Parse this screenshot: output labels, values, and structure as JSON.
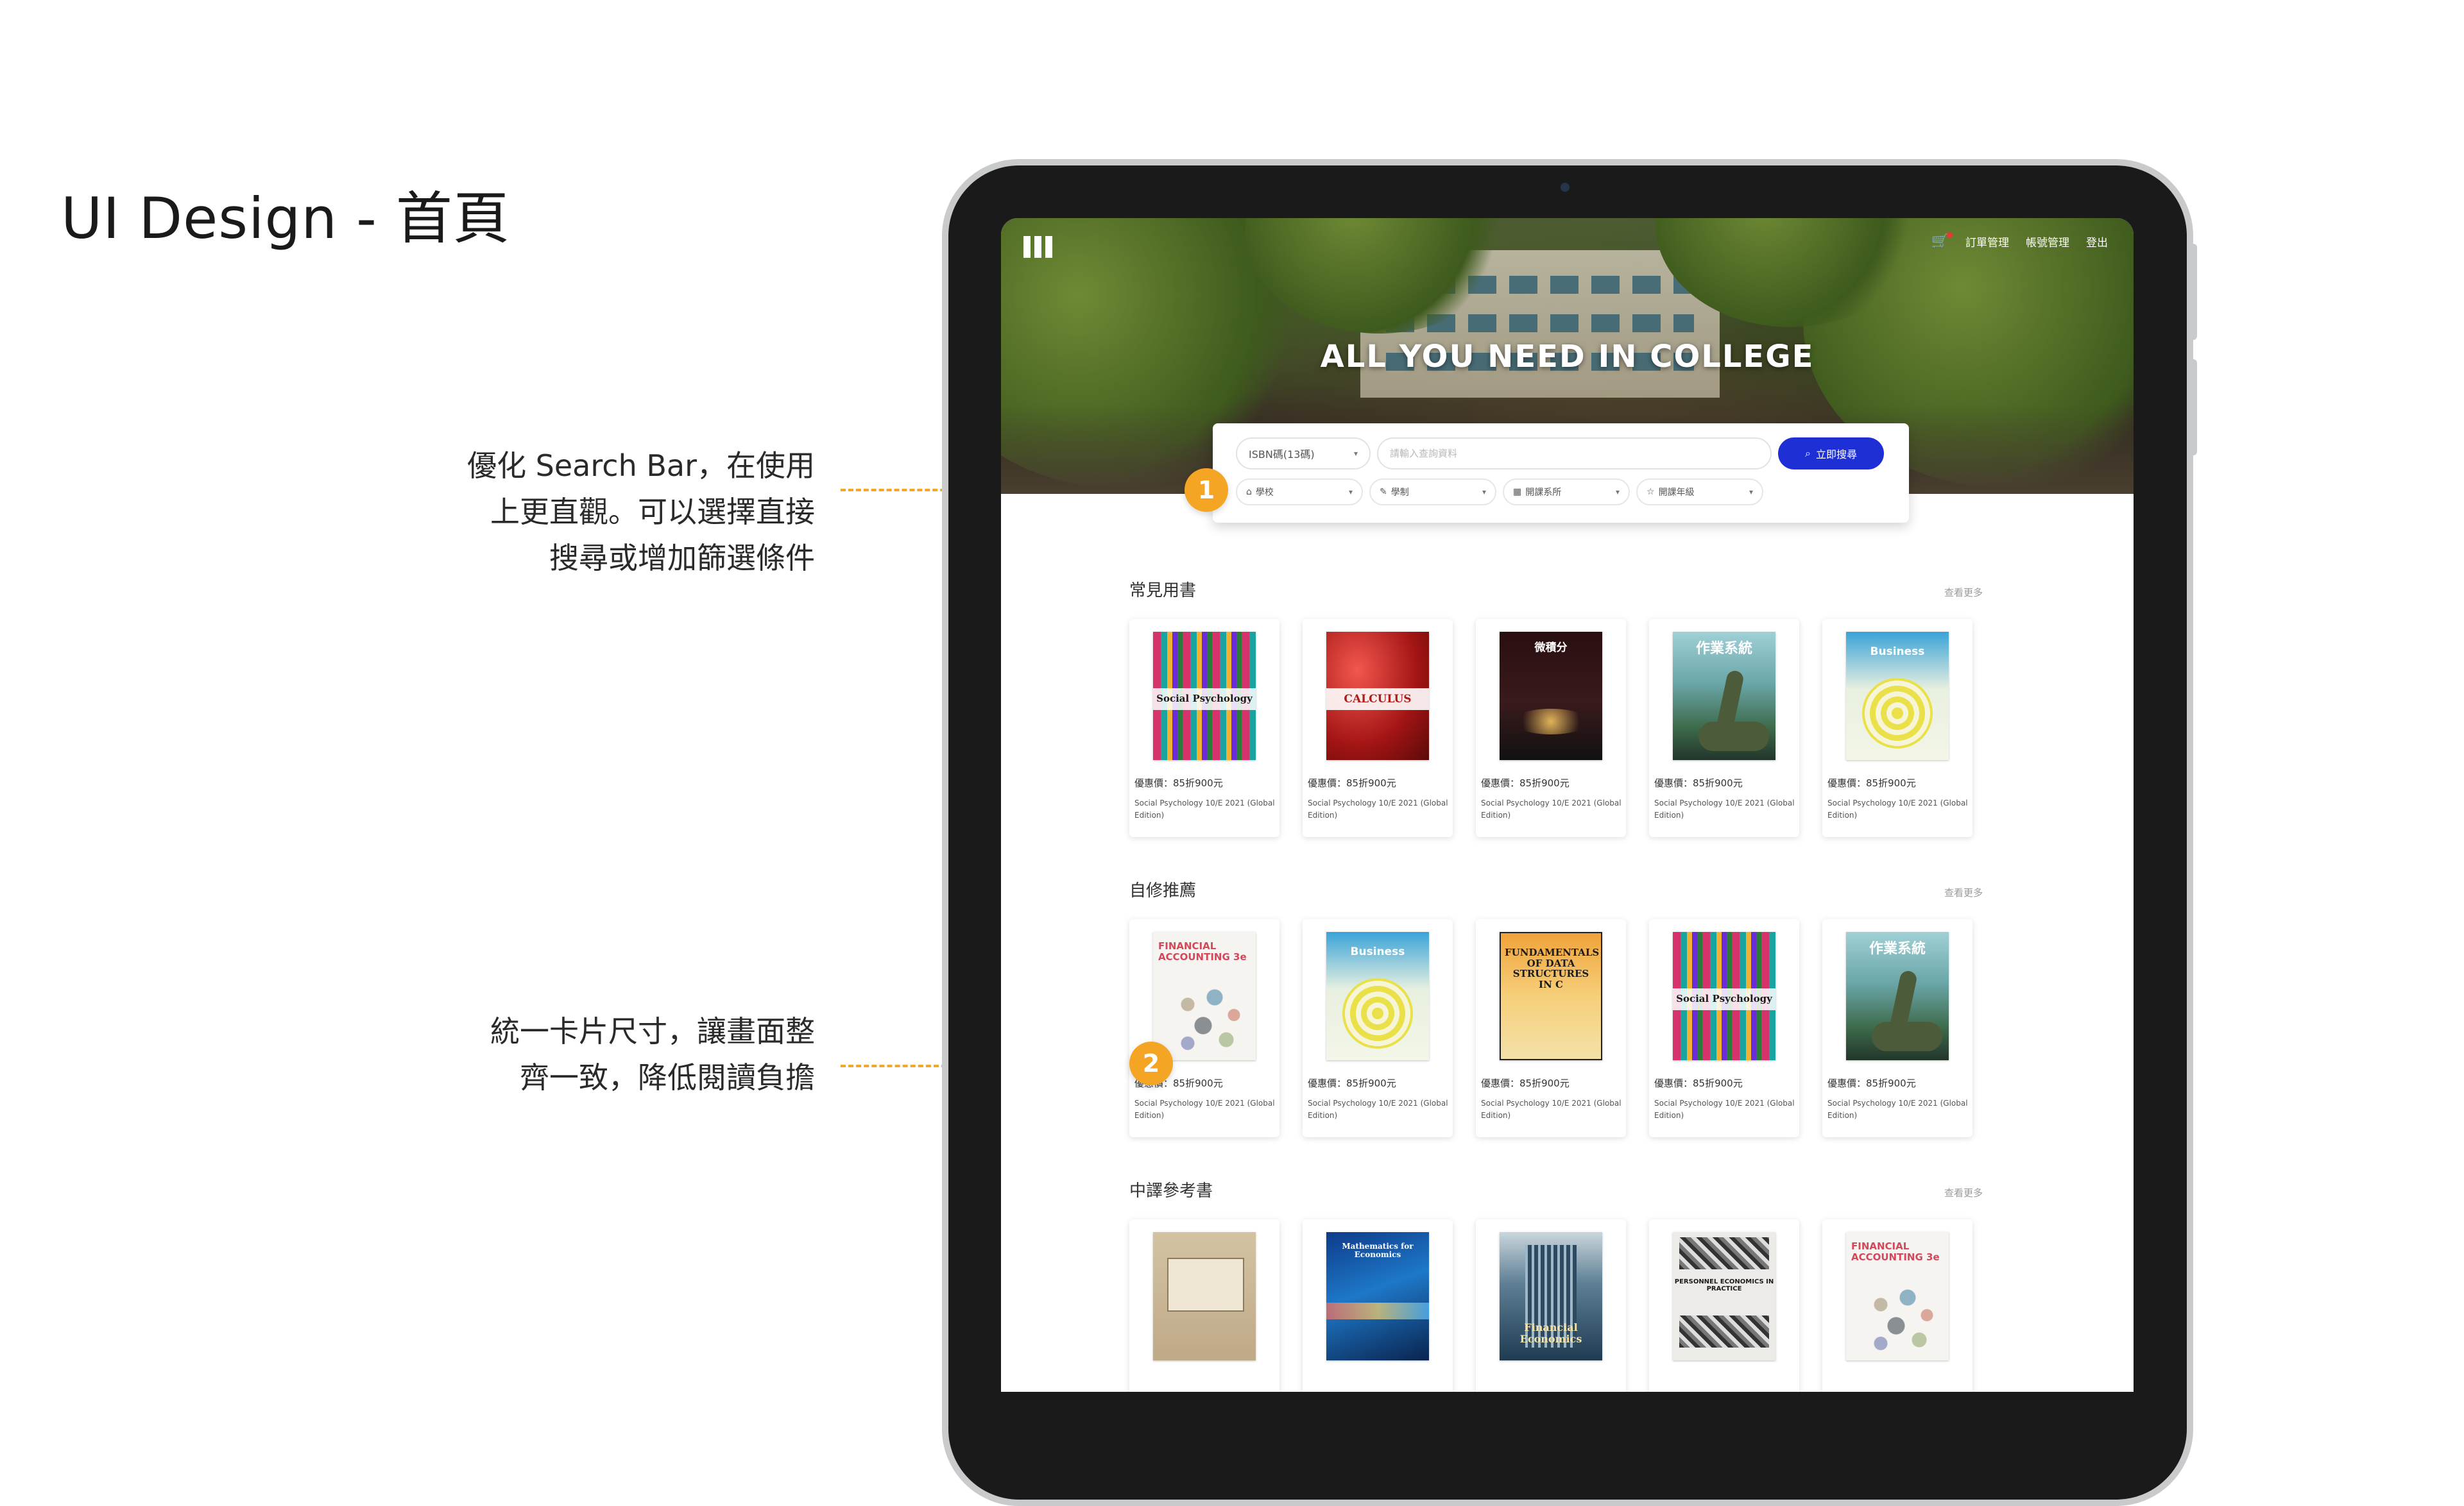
{
  "slide": {
    "title": "UI Design - 首頁",
    "annotation_1": [
      "優化 Search Bar，在使用",
      "上更直觀。可以選擇直接",
      "搜尋或增加篩選條件"
    ],
    "annotation_2": [
      "統一卡片尺寸，讓畫面整",
      "齊一致，降低閱讀負擔"
    ],
    "badge_1": "1",
    "badge_2": "2",
    "accent_color": "#f5a524"
  },
  "nav": {
    "logo_icon": "bars-logo-icon",
    "cart_icon": "cart-icon",
    "items": [
      "訂單管理",
      "帳號管理",
      "登出"
    ]
  },
  "hero": {
    "title": "ALL YOU NEED IN COLLEGE"
  },
  "search": {
    "type_select": "ISBN碼(13碼)",
    "input_placeholder": "請輸入查詢資料",
    "button_label": "立即搜尋",
    "button_color": "#1e2fd6",
    "filters": [
      {
        "icon": "school-icon",
        "label": "學校"
      },
      {
        "icon": "graduation-cap-icon",
        "label": "學制"
      },
      {
        "icon": "building-icon",
        "label": "開課系所"
      },
      {
        "icon": "star-icon",
        "label": "開課年級"
      }
    ]
  },
  "sections": [
    {
      "title": "常見用書",
      "more": "查看更多",
      "books": [
        {
          "cover": "social-psychology",
          "cover_text": "Social Psychology",
          "price": "優惠價：85折900元",
          "name": "Social Psychology 10/E 2021 (Global Edition)"
        },
        {
          "cover": "calculus",
          "cover_text": "CALCULUS",
          "price": "優惠價：85折900元",
          "name": "Social Psychology 10/E 2021 (Global Edition)"
        },
        {
          "cover": "micro",
          "cover_text": "微積分",
          "price": "優惠價：85折900元",
          "name": "Social Psychology 10/E 2021 (Global Edition)"
        },
        {
          "cover": "dino",
          "cover_text": "作業系統",
          "price": "優惠價：85折900元",
          "name": "Social Psychology 10/E 2021 (Global Edition)"
        },
        {
          "cover": "business",
          "cover_text": "Business",
          "price": "優惠價：85折900元",
          "name": "Social Psychology 10/E 2021 (Global Edition)"
        }
      ]
    },
    {
      "title": "自修推薦",
      "more": "查看更多",
      "books": [
        {
          "cover": "accounting",
          "cover_text": "FINANCIAL ACCOUNTING 3e",
          "price": "優惠價：85折900元",
          "name": "Social Psychology 10/E 2021 (Global Edition)"
        },
        {
          "cover": "business",
          "cover_text": "Business",
          "price": "優惠價：85折900元",
          "name": "Social Psychology 10/E 2021 (Global Edition)"
        },
        {
          "cover": "data-structures",
          "cover_text": "FUNDAMENTALS OF DATA STRUCTURES IN C",
          "price": "優惠價：85折900元",
          "name": "Social Psychology 10/E 2021 (Global Edition)"
        },
        {
          "cover": "social-psychology",
          "cover_text": "Social Psychology",
          "price": "優惠價：85折900元",
          "name": "Social Psychology 10/E 2021 (Global Edition)"
        },
        {
          "cover": "dino",
          "cover_text": "作業系統",
          "price": "優惠價：85折900元",
          "name": "Social Psychology 10/E 2021 (Global Edition)"
        }
      ]
    },
    {
      "title": "中譯參考書",
      "more": "查看更多",
      "books": [
        {
          "cover": "tw-ref",
          "cover_text": "",
          "price": "",
          "name": ""
        },
        {
          "cover": "math-econ",
          "cover_text": "Mathematics for Economics",
          "price": "",
          "name": ""
        },
        {
          "cover": "fin-econ",
          "cover_text": "Financial Economics",
          "price": "",
          "name": ""
        },
        {
          "cover": "personnel",
          "cover_text": "PERSONNEL ECONOMICS IN PRACTICE",
          "price": "",
          "name": ""
        },
        {
          "cover": "accounting",
          "cover_text": "FINANCIAL ACCOUNTING 3e",
          "price": "",
          "name": ""
        }
      ]
    }
  ]
}
